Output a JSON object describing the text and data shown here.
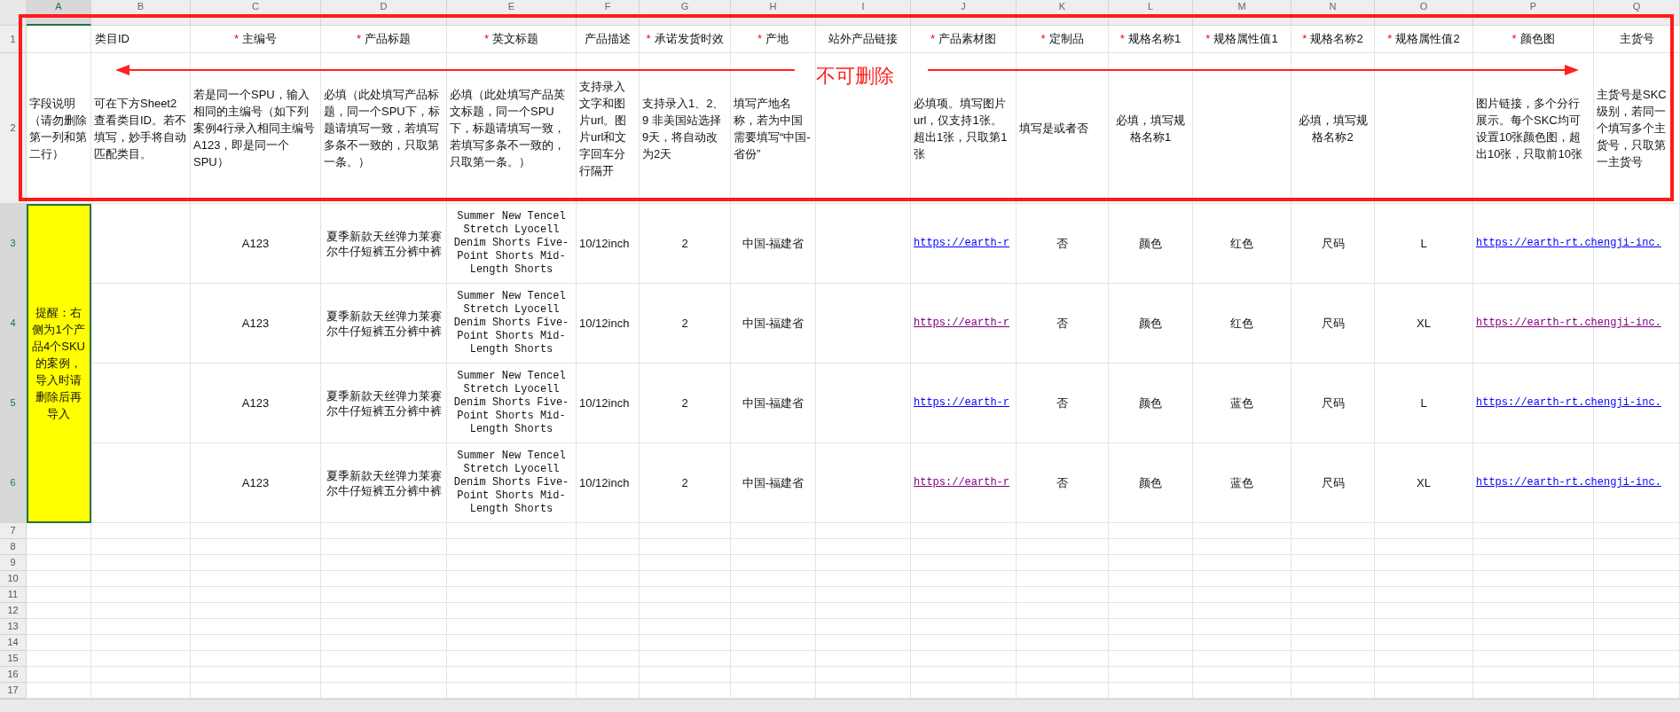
{
  "columns": [
    {
      "letter": "A",
      "selected": true
    },
    {
      "letter": "B",
      "selected": false
    },
    {
      "letter": "C",
      "selected": false
    },
    {
      "letter": "D",
      "selected": false
    },
    {
      "letter": "E",
      "selected": false
    },
    {
      "letter": "F",
      "selected": false
    },
    {
      "letter": "G",
      "selected": false
    },
    {
      "letter": "H",
      "selected": false
    },
    {
      "letter": "I",
      "selected": false
    },
    {
      "letter": "J",
      "selected": false
    },
    {
      "letter": "K",
      "selected": false
    },
    {
      "letter": "L",
      "selected": false
    },
    {
      "letter": "M",
      "selected": false
    },
    {
      "letter": "N",
      "selected": false
    },
    {
      "letter": "O",
      "selected": false
    },
    {
      "letter": "P",
      "selected": false
    },
    {
      "letter": "Q",
      "selected": false
    }
  ],
  "row_numbers": [
    {
      "label": "1",
      "selected": false
    },
    {
      "label": "2",
      "selected": false
    },
    {
      "label": "3",
      "selected": true
    },
    {
      "label": "4",
      "selected": true
    },
    {
      "label": "5",
      "selected": true
    },
    {
      "label": "6",
      "selected": true
    },
    {
      "label": "7",
      "selected": false
    },
    {
      "label": "8",
      "selected": false
    },
    {
      "label": "9",
      "selected": false
    },
    {
      "label": "10",
      "selected": false
    },
    {
      "label": "11",
      "selected": false
    },
    {
      "label": "12",
      "selected": false
    },
    {
      "label": "13",
      "selected": false
    },
    {
      "label": "14",
      "selected": false
    },
    {
      "label": "15",
      "selected": false
    },
    {
      "label": "16",
      "selected": false
    },
    {
      "label": "17",
      "selected": false
    }
  ],
  "header_row": {
    "B": {
      "label": "类目ID"
    },
    "C": {
      "mark": "*",
      "label": "主编号"
    },
    "D": {
      "mark": "*",
      "label": "产品标题"
    },
    "E": {
      "mark": "*",
      "label": "英文标题"
    },
    "F": {
      "label": "产品描述"
    },
    "G": {
      "mark": "*",
      "label": "承诺发货时效"
    },
    "H": {
      "mark": "*",
      "label": "产地"
    },
    "I": {
      "label": "站外产品链接"
    },
    "J": {
      "mark": "*",
      "label": "产品素材图"
    },
    "K": {
      "mark": "*",
      "label": "定制品"
    },
    "L": {
      "mark": "*",
      "label": "规格名称1"
    },
    "M": {
      "mark": "*",
      "label": "规格属性值1"
    },
    "N": {
      "mark": "*",
      "label": "规格名称2"
    },
    "O": {
      "mark": "*",
      "label": "规格属性值2"
    },
    "P": {
      "mark": "*",
      "label": "颜色图"
    },
    "Q": {
      "label": "主货号"
    }
  },
  "description_row": {
    "A": "字段说明（请勿删除第一列和第二行）",
    "B": "可在下方Sheet2查看类目ID。若不填写，妙手将自动匹配类目。",
    "C": "若是同一个SPU，输入相同的主编号（如下列案例4行录入相同主编号A123，即是同一个SPU）",
    "D": "必填（此处填写产品标题，同一个SPU下，标题请填写一致，若填写多条不一致的，只取第一条。）",
    "E": "必填（此处填写产品英文标题，同一个SPU下，标题请填写一致，若填写多条不一致的，只取第一条。）",
    "F": "支持录入文字和图片url。图片url和文字回车分行隔开",
    "G": "支持录入1、2、9 非美国站选择9天，将自动改为2天",
    "H": "填写产地名称，若为中国需要填写“中国-省份”",
    "J": "必填项。填写图片url，仅支持1张。超出1张，只取第1张",
    "K": "填写是或者否",
    "L": "必填，填写规格名称1",
    "N": "必填，填写规格名称2",
    "P": "图片链接，多个分行展示。每个SKC均可设置10张颜色图，超出10张，只取前10张",
    "Q": "主货号是SKC级别，若同一个填写多个主货号，只取第一主货号"
  },
  "note_cell": {
    "text": "提醒：右侧为1个产品4个SKU的案例，导入时请删除后再导入",
    "selected": true
  },
  "data_rows": [
    {
      "cells": {
        "C": {
          "text": "A123"
        },
        "D": {
          "text": "夏季新款天丝弹力莱赛尔牛仔短裤五分裤中裤"
        },
        "E": {
          "text": "Summer New Tencel Stretch Lyocell Denim Shorts Five-Point Shorts Mid-Length Shorts"
        },
        "F": {
          "text": "10/12inch"
        },
        "G": {
          "text": "2"
        },
        "H": {
          "text": "中国-福建省"
        },
        "J": {
          "kind": "link",
          "text": "https://earth-r",
          "visited": false
        },
        "K": {
          "text": "否"
        },
        "L": {
          "text": "颜色"
        },
        "M": {
          "text": "红色"
        },
        "N": {
          "text": "尺码"
        },
        "O": {
          "text": "L"
        },
        "P": {
          "kind": "link",
          "text": "https://earth-rt.chengji-inc.",
          "visited": false
        }
      }
    },
    {
      "cells": {
        "C": {
          "text": "A123"
        },
        "D": {
          "text": "夏季新款天丝弹力莱赛尔牛仔短裤五分裤中裤"
        },
        "E": {
          "text": "Summer New Tencel Stretch Lyocell Denim Shorts Five-Point Shorts Mid-Length Shorts"
        },
        "F": {
          "text": "10/12inch"
        },
        "G": {
          "text": "2"
        },
        "H": {
          "text": "中国-福建省"
        },
        "J": {
          "kind": "link",
          "text": "https://earth-r",
          "visited": true
        },
        "K": {
          "text": "否"
        },
        "L": {
          "text": "颜色"
        },
        "M": {
          "text": "红色"
        },
        "N": {
          "text": "尺码"
        },
        "O": {
          "text": "XL"
        },
        "P": {
          "kind": "link",
          "text": "https://earth-rt.chengji-inc.",
          "visited": true
        }
      }
    },
    {
      "cells": {
        "C": {
          "text": "A123"
        },
        "D": {
          "text": "夏季新款天丝弹力莱赛尔牛仔短裤五分裤中裤"
        },
        "E": {
          "text": "Summer New Tencel Stretch Lyocell Denim Shorts Five-Point Shorts Mid-Length Shorts"
        },
        "F": {
          "text": "10/12inch"
        },
        "G": {
          "text": "2"
        },
        "H": {
          "text": "中国-福建省"
        },
        "J": {
          "kind": "link",
          "text": "https://earth-r",
          "visited": false
        },
        "K": {
          "text": "否"
        },
        "L": {
          "text": "颜色"
        },
        "M": {
          "text": "蓝色"
        },
        "N": {
          "text": "尺码"
        },
        "O": {
          "text": "L"
        },
        "P": {
          "kind": "link",
          "text": "https://earth-rt.chengji-inc.",
          "visited": false
        }
      }
    },
    {
      "cells": {
        "C": {
          "text": "A123"
        },
        "D": {
          "text": "夏季新款天丝弹力莱赛尔牛仔短裤五分裤中裤"
        },
        "E": {
          "text": "Summer New Tencel Stretch Lyocell Denim Shorts Five-Point Shorts Mid-Length Shorts"
        },
        "F": {
          "text": "10/12inch"
        },
        "G": {
          "text": "2"
        },
        "H": {
          "text": "中国-福建省"
        },
        "J": {
          "kind": "link",
          "text": "https://earth-r",
          "visited": true
        },
        "K": {
          "text": "否"
        },
        "L": {
          "text": "颜色"
        },
        "M": {
          "text": "蓝色"
        },
        "N": {
          "text": "尺码"
        },
        "O": {
          "text": "XL"
        },
        "P": {
          "kind": "link",
          "text": "https://earth-rt.chengji-inc.",
          "visited": false
        }
      }
    }
  ],
  "annotation": {
    "label": "不可删除"
  }
}
